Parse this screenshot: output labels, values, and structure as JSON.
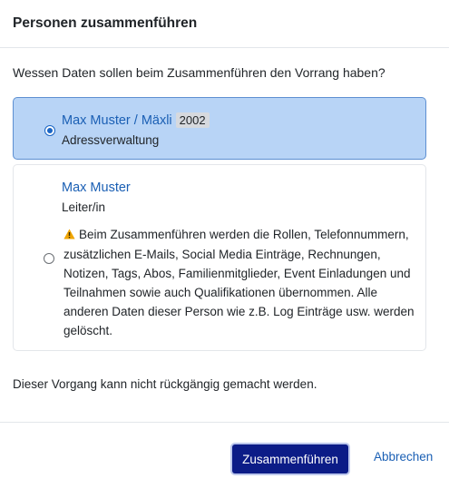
{
  "dialog": {
    "title": "Personen zusammenführen",
    "question": "Wessen Daten sollen beim Zusammenführen den Vorrang haben?",
    "options": [
      {
        "name": "Max Muster / Mäxli",
        "badge": "2002",
        "role": "Adressverwaltung",
        "selected": true
      },
      {
        "name": "Max Muster",
        "role": "Leiter/in",
        "warning": "Beim Zusammenführen werden die Rollen, Telefonnummern, zusätzlichen E-Mails, Social Media Einträge, Rechnungen, Notizen, Tags, Abos, Familienmitglieder, Event Einladungen und Teilnahmen sowie auch Qualifikationen übernommen. Alle anderen Daten dieser Person wie z.B. Log Einträge usw. werden gelöscht.",
        "selected": false
      }
    ],
    "note": "Dieser Vorgang kann nicht rückgängig gemacht werden.",
    "confirm_label": "Zusammenführen",
    "cancel_label": "Abbrechen"
  },
  "colors": {
    "selected_bg": "#b8d4f6",
    "link": "#1a5fb4",
    "primary_button": "#0c1c87",
    "warning": "#f0a500"
  },
  "icons": {
    "warning": "warning-icon"
  }
}
